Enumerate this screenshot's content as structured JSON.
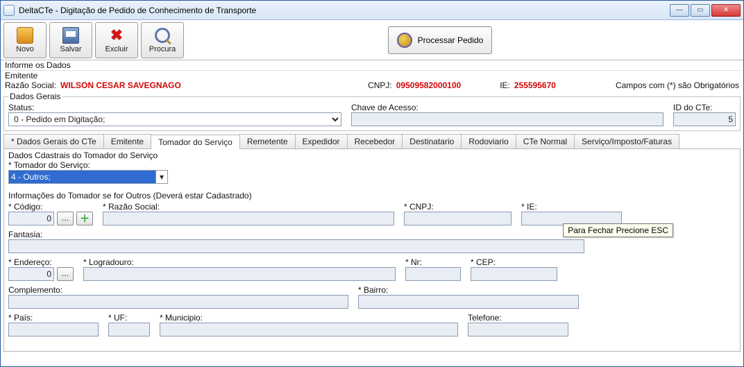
{
  "window": {
    "title": "DeltaCTe - Digitação de Pedido de Conhecimento de Transporte"
  },
  "toolbar": {
    "novo": "Novo",
    "salvar": "Salvar",
    "excluir": "Excluir",
    "procura": "Procura",
    "processar": "Processar Pedido"
  },
  "info_label": "Informe os Dados",
  "emitente": {
    "legend": "Emitente",
    "razao_label": "Razão Social:",
    "razao_value": "WILSON CESAR SAVEGNAGO",
    "cnpj_label": "CNPJ:",
    "cnpj_value": "09509582000100",
    "ie_label": "IE:",
    "ie_value": "255595670",
    "req_label": "Campos com (*) são Obrigatórios"
  },
  "dados_gerais": {
    "legend": "Dados Gerais",
    "status_label": "Status:",
    "status_value": "0 - Pedido em Digitação;",
    "chave_label": "Chave de Acesso:",
    "chave_value": "",
    "id_label": "ID do CTe:",
    "id_value": "5"
  },
  "tabs": [
    {
      "label": "* Dados Gerais do CTe",
      "active": false
    },
    {
      "label": "Emitente",
      "active": false
    },
    {
      "label": "Tomador do Serviço",
      "active": true
    },
    {
      "label": "Remetente",
      "active": false
    },
    {
      "label": "Expedidor",
      "active": false
    },
    {
      "label": "Recebedor",
      "active": false
    },
    {
      "label": "Destinatario",
      "active": false
    },
    {
      "label": "Rodoviario",
      "active": false
    },
    {
      "label": "CTe Normal",
      "active": false
    },
    {
      "label": "Serviço/Imposto/Faturas",
      "active": false
    }
  ],
  "tomador": {
    "subfieldset_legend": "Dados Cdastrais do Tomador do Serviço",
    "tomador_label": "* Tomador do Serviço:",
    "tomador_value": "4 - Outros;",
    "info_label": "Informações do Tomador se for Outros (Deverá estar Cadastrado)",
    "codigo_label": "* Código:",
    "codigo_value": "0",
    "razao_label": "* Razão Social:",
    "razao_value": "",
    "cnpj_label": "* CNPJ:",
    "cnpj_value": "",
    "ie_label": "* IE:",
    "ie_value": "",
    "fantasia_label": "Fantasia:",
    "fantasia_value": "",
    "endereco_label": "* Endereço:",
    "endereco_value": "0",
    "logradouro_label": "* Logradouro:",
    "logradouro_value": "",
    "nr_label": "* Nr:",
    "nr_value": "",
    "cep_label": "* CEP:",
    "cep_value": "",
    "complemento_label": "Complemento:",
    "complemento_value": "",
    "bairro_label": "* Bairro:",
    "bairro_value": "",
    "pais_label": "* País:",
    "pais_value": "",
    "uf_label": "* UF:",
    "uf_value": "",
    "municipio_label": "* Municipio:",
    "municipio_value": "",
    "telefone_label": "Telefone:",
    "telefone_value": ""
  },
  "tooltip": "Para Fechar Precione ESC"
}
